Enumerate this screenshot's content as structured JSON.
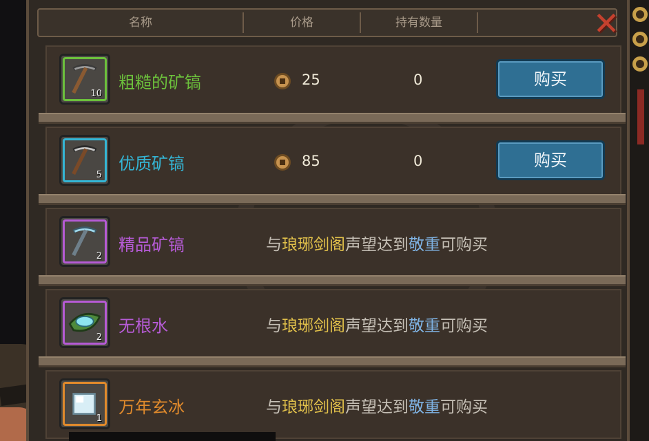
{
  "header": {
    "col_name": "名称",
    "col_price": "价格",
    "col_owned": "持有数量"
  },
  "items": [
    {
      "name": "粗糙的矿镐",
      "count": "10",
      "price": "25",
      "owned": "0",
      "buy_label": "购买",
      "rarity_color": "#6cc13c",
      "icon": "pickaxe-icon"
    },
    {
      "name": "优质矿镐",
      "count": "5",
      "price": "85",
      "owned": "0",
      "buy_label": "购买",
      "rarity_color": "#34b6d6",
      "icon": "pickaxe-icon"
    },
    {
      "name": "精品矿镐",
      "count": "2",
      "requirement": {
        "prefix": "与",
        "faction": "琅琊剑阁",
        "middle": "声望达到",
        "rank": "敬重",
        "suffix": "可购买"
      },
      "rarity_color": "#b65bd6",
      "icon": "pickaxe-icon"
    },
    {
      "name": "无根水",
      "count": "2",
      "requirement": {
        "prefix": "与",
        "faction": "琅琊剑阁",
        "middle": "声望达到",
        "rank": "敬重",
        "suffix": "可购买"
      },
      "rarity_color": "#b65bd6",
      "icon": "water-leaf-icon"
    },
    {
      "name": "万年玄冰",
      "count": "1",
      "requirement": {
        "prefix": "与",
        "faction": "琅琊剑阁",
        "middle": "声望达到",
        "rank": "敬重",
        "suffix": "可购买"
      },
      "rarity_color": "#e08a2c",
      "icon": "ice-cube-icon"
    }
  ],
  "colors": {
    "green": "#6cc13c",
    "cyan": "#34b6d6",
    "purple": "#b65bd6",
    "orange": "#e08a2c",
    "button": "#2f6f93"
  }
}
